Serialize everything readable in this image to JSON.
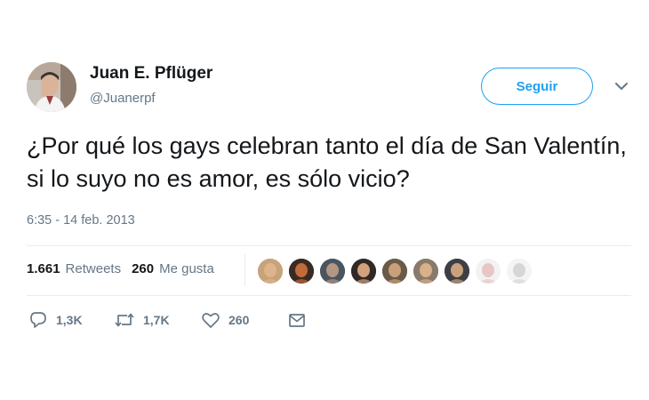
{
  "author": {
    "name": "Juan E. Pflüger",
    "handle": "@Juanerpf",
    "avatar_icon": "profile-photo"
  },
  "follow_button": {
    "label": "Seguir",
    "color": "#1da1f2"
  },
  "tweet": {
    "text": "¿Por qué los gays celebran tanto el día de San Valentín, si lo suyo no es amor, es sólo vicio?",
    "timestamp": "6:35 - 14 feb. 2013"
  },
  "stats": {
    "retweets_count": "1.661",
    "retweets_label": "Retweets",
    "likes_count": "260",
    "likes_label": "Me gusta"
  },
  "likers": [
    {
      "bg": "#c7a37a",
      "face": "#e0b48a"
    },
    {
      "bg": "#3a2a22",
      "face": "#c26a3a"
    },
    {
      "bg": "#4a5560",
      "face": "#b39683"
    },
    {
      "bg": "#2f2a28",
      "face": "#d1a27c"
    },
    {
      "bg": "#6b5a48",
      "face": "#c9a07a"
    },
    {
      "bg": "#8a7a6a",
      "face": "#d8b08a"
    },
    {
      "bg": "#3c3f44",
      "face": "#caa17f"
    },
    {
      "bg": "#f2f2f2",
      "face": "#e8c6c6"
    },
    {
      "bg": "#f4f4f4",
      "face": "#d6d6d6"
    }
  ],
  "actions": {
    "reply_count": "1,3K",
    "retweet_count": "1,7K",
    "like_count": "260",
    "reply_icon": "reply-icon",
    "retweet_icon": "retweet-icon",
    "like_icon": "heart-icon",
    "dm_icon": "envelope-icon"
  },
  "colors": {
    "text": "#14171a",
    "secondary": "#657786",
    "divider": "#e6ecf0",
    "accent": "#1da1f2"
  }
}
